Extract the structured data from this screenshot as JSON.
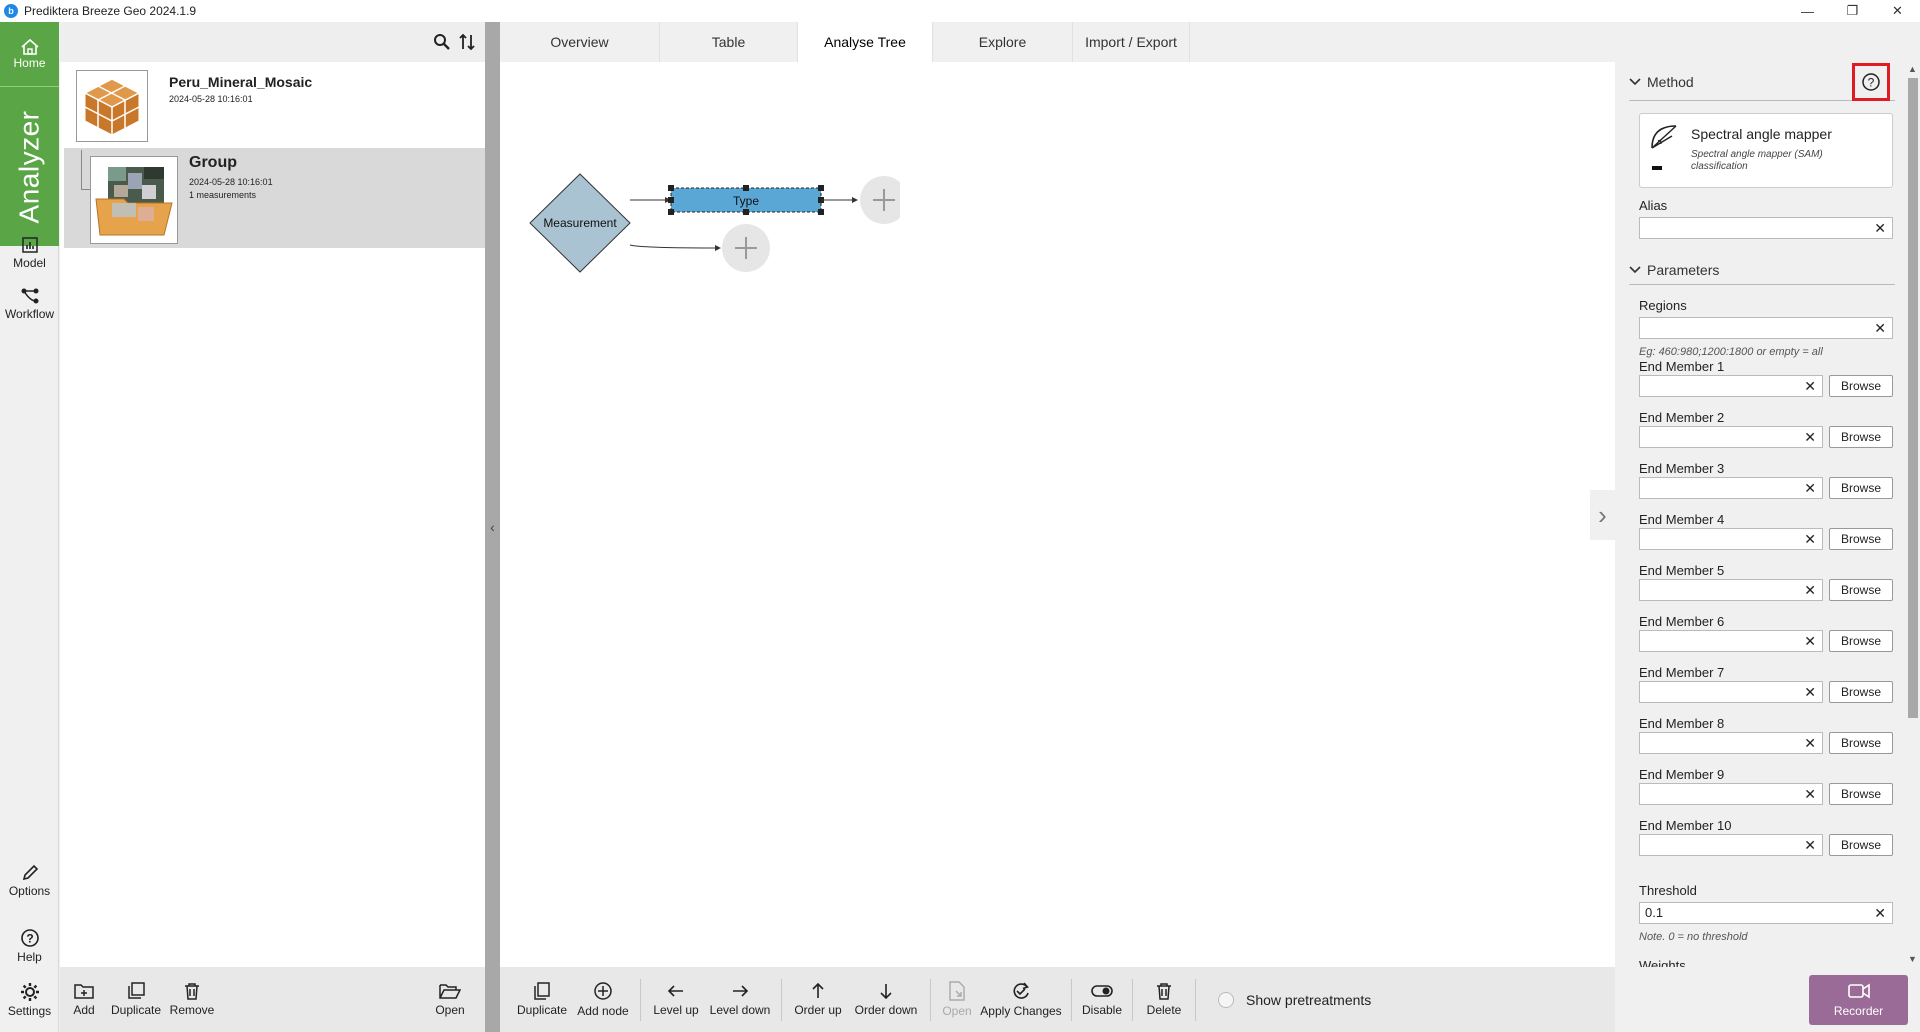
{
  "window": {
    "title": "Prediktera Breeze Geo 2024.1.9",
    "minimize": "—",
    "restore": "❐",
    "close": "✕"
  },
  "nav": {
    "home": "Home",
    "analyzer": "Analyzer",
    "model": "Model",
    "workflow": "Workflow",
    "options": "Options",
    "help": "Help",
    "settings": "Settings"
  },
  "project": {
    "name": "Peru_Mineral_Mosaic",
    "date": "2024-05-28 10:16:01",
    "group": {
      "name": "Group",
      "date": "2024-05-28 10:16:01",
      "count": "1 measurements"
    }
  },
  "tabs": [
    "Overview",
    "Table",
    "Analyse Tree",
    "Explore",
    "Import / Export"
  ],
  "active_tab": "Analyse Tree",
  "tree": {
    "root": "Measurement",
    "node": "Type"
  },
  "method": {
    "section": "Method",
    "name": "Spectral angle mapper",
    "description": "Spectral angle mapper (SAM) classification",
    "alias_label": "Alias",
    "alias_value": ""
  },
  "parameters": {
    "section": "Parameters",
    "regions_label": "Regions",
    "regions_value": "",
    "regions_hint": "Eg: 460:980;1200:1800 or empty = all",
    "browse_label": "Browse",
    "end_members": [
      "End Member 1",
      "End Member 2",
      "End Member 3",
      "End Member 4",
      "End Member 5",
      "End Member 6",
      "End Member 7",
      "End Member 8",
      "End Member 9",
      "End Member 10"
    ],
    "threshold_label": "Threshold",
    "threshold_value": "0.1",
    "threshold_note": "Note. 0 = no threshold",
    "weights_label": "Weights"
  },
  "left_toolbar": {
    "add": "Add",
    "duplicate": "Duplicate",
    "remove": "Remove",
    "open": "Open"
  },
  "tree_toolbar": {
    "duplicate": "Duplicate",
    "add_node": "Add node",
    "level_up": "Level up",
    "level_down": "Level down",
    "order_up": "Order up",
    "order_down": "Order down",
    "open": "Open",
    "apply_changes": "Apply Changes",
    "disable": "Disable",
    "delete": "Delete",
    "show_pretreatments": "Show pretreatments"
  },
  "recorder": "Recorder",
  "colors": {
    "accent_green": "#5aa646",
    "node_blue": "#5aa7d6",
    "highlight_red": "#e01b24",
    "recorder": "#9b6b97"
  }
}
